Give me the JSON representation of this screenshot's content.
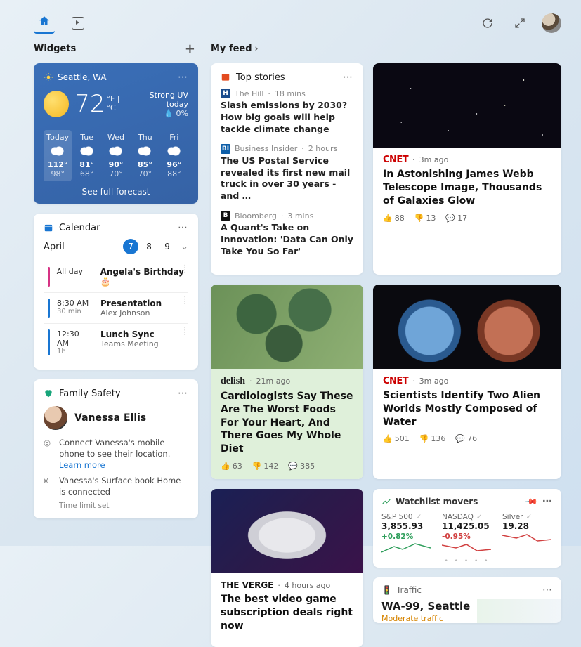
{
  "sections": {
    "widgets": "Widgets",
    "feed": "My feed"
  },
  "weather": {
    "location": "Seattle, WA",
    "temp": "72",
    "unit": "°F |°C",
    "uv": "Strong UV today",
    "precip": "0%",
    "days": [
      {
        "name": "Today",
        "hi": "112°",
        "lo": "98°"
      },
      {
        "name": "Tue",
        "hi": "81°",
        "lo": "68°"
      },
      {
        "name": "Wed",
        "hi": "90°",
        "lo": "70°"
      },
      {
        "name": "Thu",
        "hi": "85°",
        "lo": "70°"
      },
      {
        "name": "Fri",
        "hi": "96°",
        "lo": "88°"
      }
    ],
    "link": "See full forecast"
  },
  "calendar": {
    "title": "Calendar",
    "month": "April",
    "dates": [
      "7",
      "8",
      "9"
    ],
    "selected": "7",
    "events": [
      {
        "bar": "#d63384",
        "time": "All day",
        "dur": "",
        "title": "Angela's Birthday 🎂",
        "sub": ""
      },
      {
        "bar": "#1976d2",
        "time": "8:30 AM",
        "dur": "30 min",
        "title": "Presentation",
        "sub": "Alex Johnson"
      },
      {
        "bar": "#1976d2",
        "time": "12:30 AM",
        "dur": "1h",
        "title": "Lunch Sync",
        "sub": "Teams Meeting"
      }
    ]
  },
  "family": {
    "title": "Family Safety",
    "person": "Vanessa Ellis",
    "loc_text": "Connect Vanessa's mobile phone to see their location.",
    "learn": "Learn more",
    "device_text": "Vanessa's Surface book Home is connected",
    "device_sub": "Time limit set"
  },
  "topstories": {
    "title": "Top stories",
    "items": [
      {
        "badge": "H",
        "badge_bg": "#1a4b8c",
        "source": "The Hill",
        "age": "18 mins",
        "title": "Slash emissions by 2030? How big goals will help tackle climate change"
      },
      {
        "badge": "BI",
        "badge_bg": "#0d5ea8",
        "source": "Business Insider",
        "age": "2 hours",
        "title": "The US Postal Service revealed its first new mail truck in over 30 years - and …"
      },
      {
        "badge": "B",
        "badge_bg": "#111",
        "source": "Bloomberg",
        "age": "3 mins",
        "title": "A Quant's Take on Innovation: 'Data Can Only Take You So Far'"
      }
    ]
  },
  "feed": [
    {
      "kind": "image",
      "img": "stars",
      "source_class": "src-cnet",
      "source": "CNET",
      "age": "3m ago",
      "headline": "In Astonishing James Webb Telescope Image, Thousands of Galaxies Glow",
      "like": "88",
      "dis": "13",
      "com": "17"
    },
    {
      "kind": "image",
      "img": "celery",
      "source_class": "src-delish",
      "source": "delish",
      "age": "21m ago",
      "headline": "Cardiologists Say These Are The Worst Foods For Your Heart, And There Goes My Whole Diet",
      "like": "63",
      "dis": "142",
      "com": "385"
    },
    {
      "kind": "image",
      "img": "planets",
      "source_class": "src-cnet",
      "source": "CNET",
      "age": "3m ago",
      "headline": "Scientists Identify Two Alien Worlds Mostly Composed of Water",
      "like": "501",
      "dis": "136",
      "com": "76"
    },
    {
      "kind": "image",
      "img": "controller",
      "source_class": "src-verge",
      "source": "THE VERGE",
      "age": "4 hours ago",
      "headline": "The best video game subscription deals right now"
    }
  ],
  "watchlist": {
    "title": "Watchlist movers",
    "items": [
      {
        "name": "S&P 500",
        "value": "3,855.93",
        "change": "+0.82%",
        "dir": "up"
      },
      {
        "name": "NASDAQ",
        "value": "11,425.05",
        "change": "-0.95%",
        "dir": "down"
      },
      {
        "name": "Silver",
        "value": "19.28",
        "change": "",
        "dir": "down"
      }
    ]
  },
  "traffic": {
    "title": "Traffic",
    "location": "WA-99, Seattle",
    "status": "Moderate traffic"
  }
}
